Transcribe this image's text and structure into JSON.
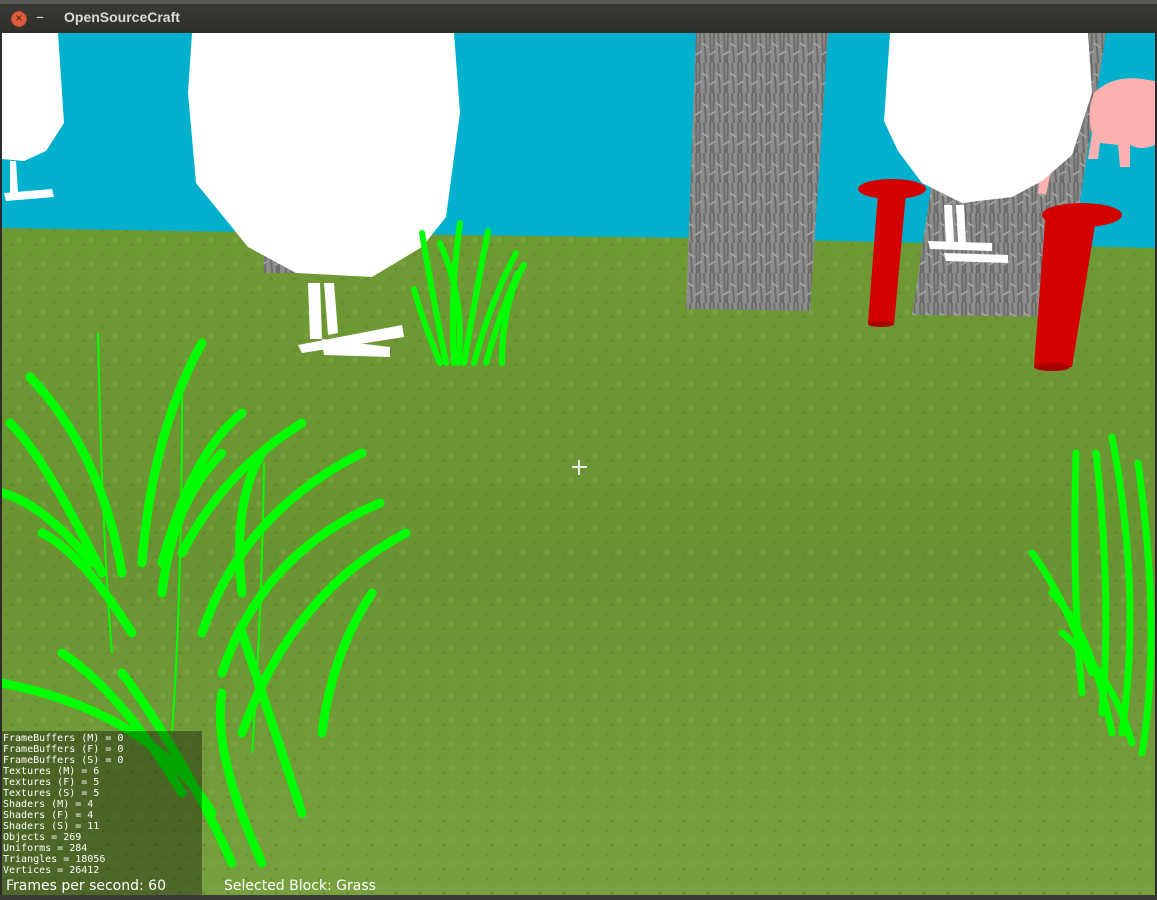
{
  "window": {
    "title": "OpenSourceCraft",
    "close_glyph": "×",
    "minimize_glyph": "–"
  },
  "hud": {
    "stats": [
      "FrameBuffers (M) = 0",
      "FrameBuffers (F) = 0",
      "FrameBuffers (S) = 0",
      "Textures (M) = 6",
      "Textures (F) = 5",
      "Textures (S) = 5",
      "Shaders (M) = 4",
      "Shaders (F) = 4",
      "Shaders (S) = 11",
      "Objects = 269",
      "Uniforms = 284",
      "Triangles = 18056",
      "Vertices = 26412"
    ],
    "fps": "Frames per second: 60",
    "selected_block": "Selected Block: Grass"
  },
  "colors": {
    "sky": "#01b0cc",
    "grass_ground": "#6f9a35",
    "grass_blades": "#00ff00",
    "sheep": "#ffffff",
    "pig": "#ffb0b0",
    "mushroom": "#d40000",
    "tree_bark": "#8a8a88"
  },
  "icons": [
    "close-icon",
    "minimize-icon",
    "crosshair-icon"
  ]
}
